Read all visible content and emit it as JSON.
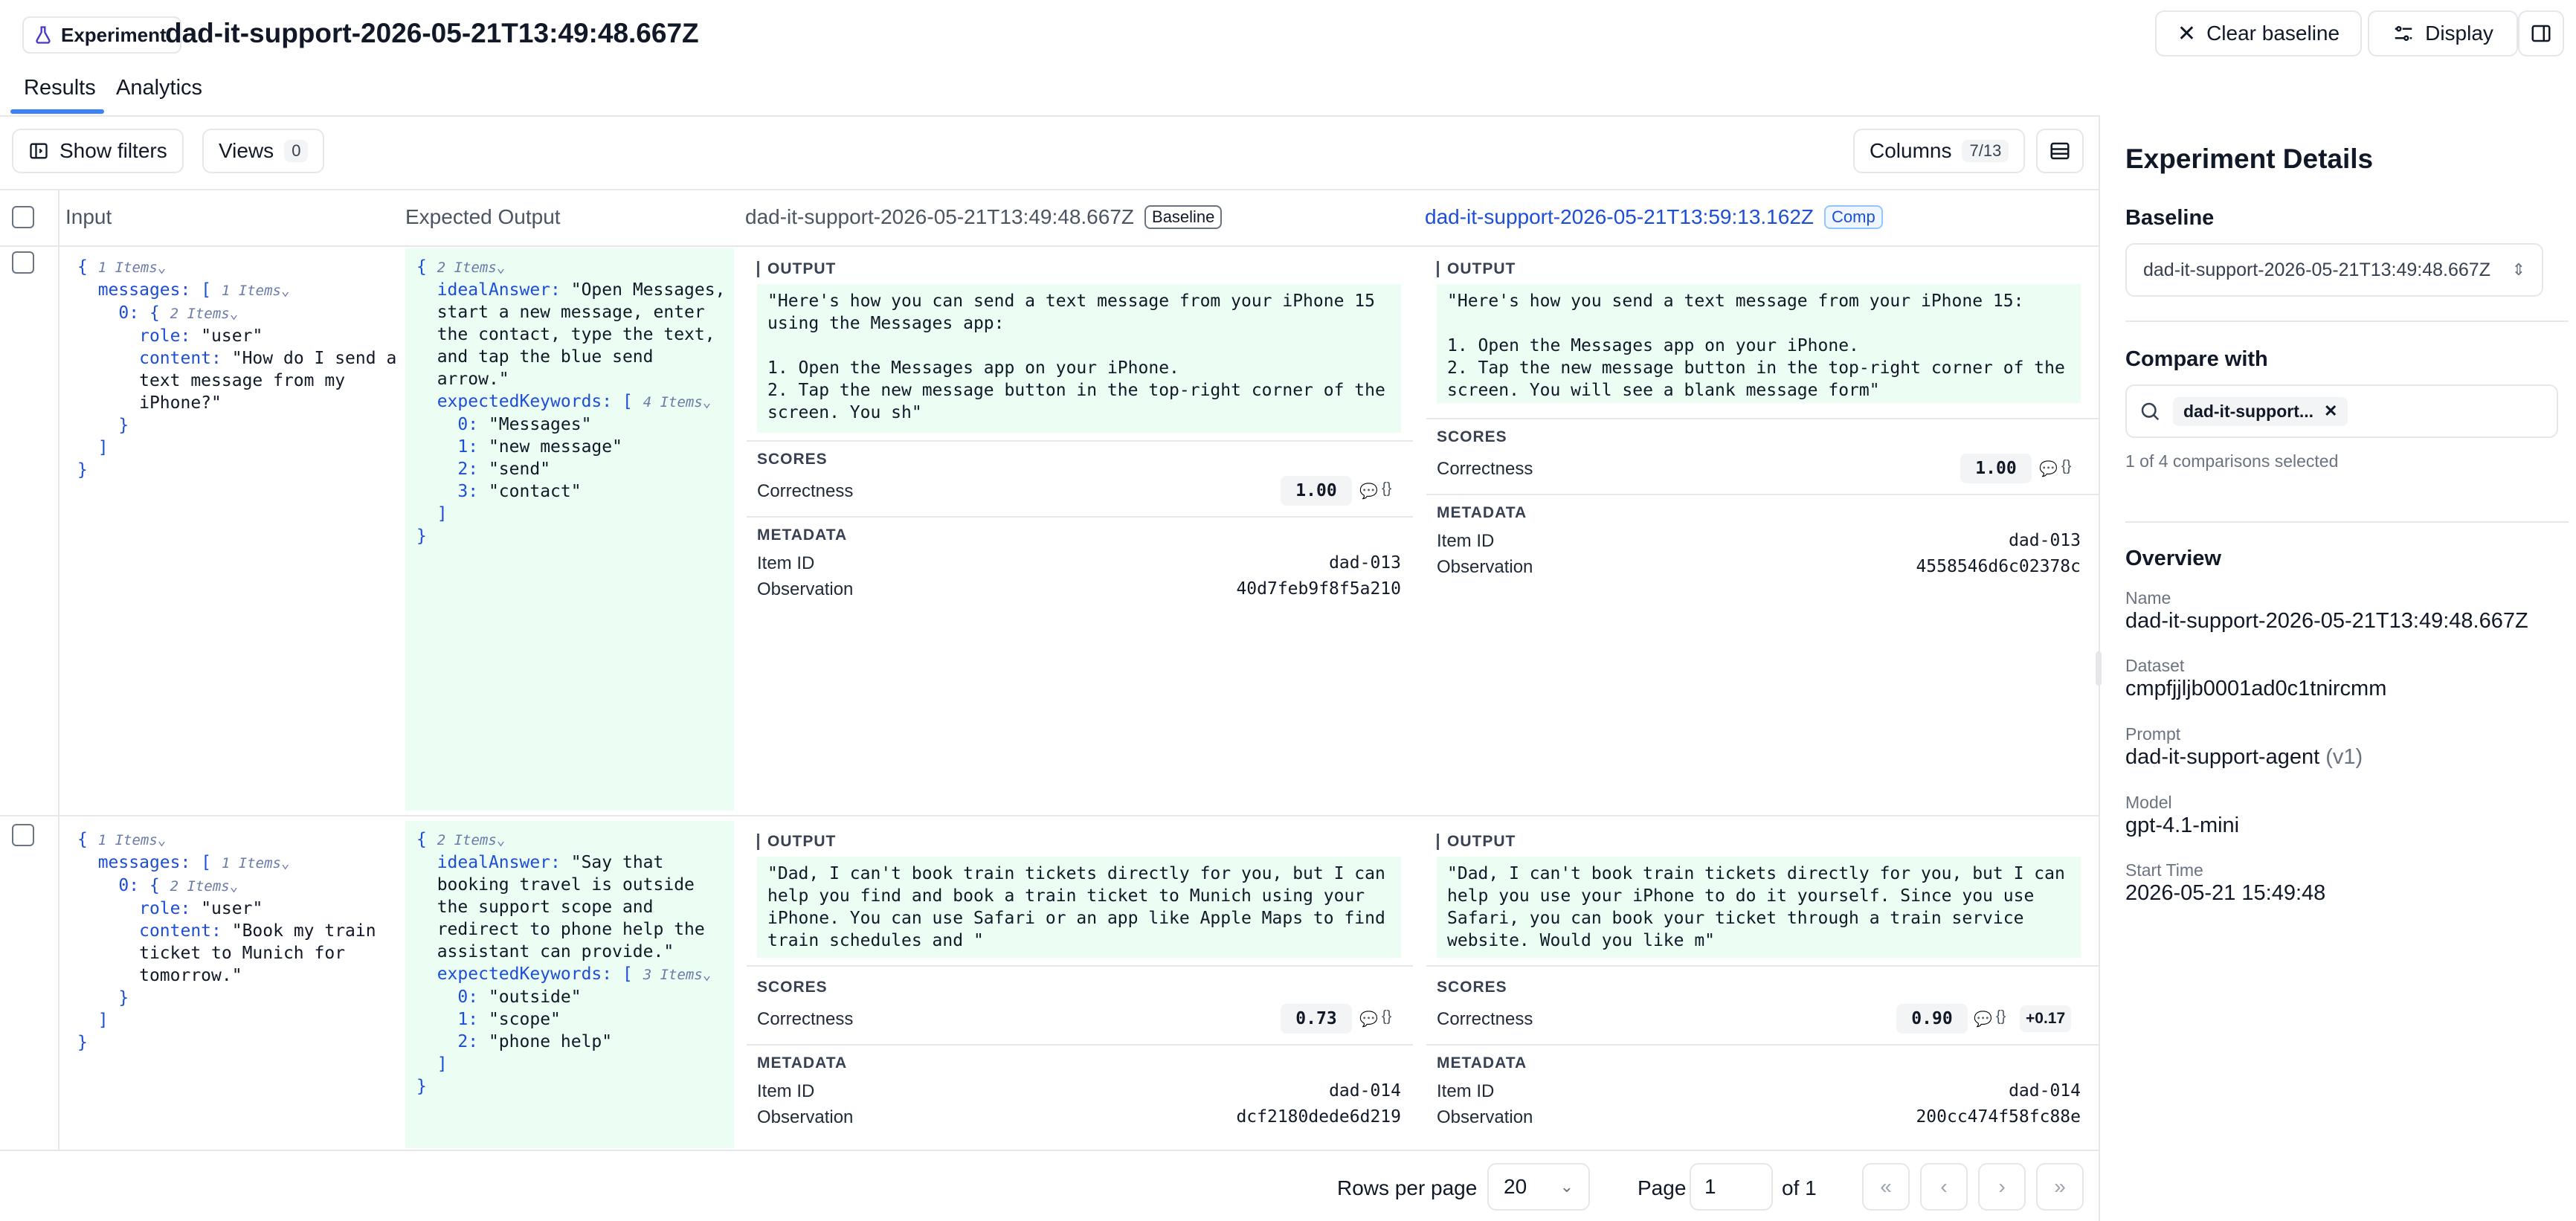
{
  "header": {
    "badge_label": "Experiment",
    "title": "dad-it-support-2026-05-21T13:49:48.667Z",
    "clear_baseline_label": "Clear baseline",
    "display_label": "Display"
  },
  "tabs": [
    {
      "label": "Results",
      "active": true
    },
    {
      "label": "Analytics",
      "active": false
    }
  ],
  "toolbar": {
    "show_filters_label": "Show filters",
    "views_label": "Views",
    "views_count": "0",
    "columns_label": "Columns",
    "columns_count": "7/13"
  },
  "columns": {
    "input": "Input",
    "expected_output": "Expected Output",
    "baseline_run": "dad-it-support-2026-05-21T13:49:48.667Z",
    "baseline_badge": "Baseline",
    "comparison_run": "dad-it-support-2026-05-21T13:59:13.162Z",
    "comparison_badge": "Comp"
  },
  "labels": {
    "output": "OUTPUT",
    "scores": "SCORES",
    "metadata": "METADATA",
    "correctness": "Correctness",
    "item_id": "Item ID",
    "observation": "Observation"
  },
  "rows": [
    {
      "input": {
        "root_meta": "1 Items",
        "messages_key": "messages:",
        "messages_meta": "1 Items",
        "item0_meta": "2 Items",
        "role": "\"user\"",
        "content_lines": [
          "\"How do I send a",
          "text message from my",
          "iPhone?\""
        ]
      },
      "expected": {
        "root_meta": "2 Items",
        "ideal_lines": [
          "\"Open Messages,",
          "start a new message, enter",
          "the contact, type the text,",
          "and tap the blue send",
          "arrow.\""
        ],
        "keywords_meta": "4 Items",
        "keywords": [
          "\"Messages\"",
          "\"new message\"",
          "\"send\"",
          "\"contact\""
        ]
      },
      "baseline": {
        "output": "\"Here's how you can send a text message from your iPhone 15\nusing the Messages app:\n\n1. Open the Messages app on your iPhone.\n2. Tap the new message button in the top-right corner of the\nscreen. You sh\"",
        "score": "1.00",
        "item_id": "dad-013",
        "observation": "40d7feb9f8f5a210"
      },
      "comparison": {
        "output": "\"Here's how you send a text message from your iPhone 15:\n\n1. Open the Messages app on your iPhone.\n2. Tap the new message button in the top-right corner of the\nscreen. You will see a blank message form\"",
        "score": "1.00",
        "delta": "",
        "item_id": "dad-013",
        "observation": "4558546d6c02378c"
      }
    },
    {
      "input": {
        "root_meta": "1 Items",
        "messages_key": "messages:",
        "messages_meta": "1 Items",
        "item0_meta": "2 Items",
        "role": "\"user\"",
        "content_lines": [
          "\"Book my train",
          "ticket to Munich for",
          "tomorrow.\""
        ]
      },
      "expected": {
        "root_meta": "2 Items",
        "ideal_lines": [
          "\"Say that",
          "booking travel is outside",
          "the support scope and",
          "redirect to phone help the",
          "assistant can provide.\""
        ],
        "keywords_meta": "3 Items",
        "keywords": [
          "\"outside\"",
          "\"scope\"",
          "\"phone help\""
        ]
      },
      "baseline": {
        "output": "\"Dad, I can't book train tickets directly for you, but I can\nhelp you find and book a train ticket to Munich using your\niPhone. You can use Safari or an app like Apple Maps to find\ntrain schedules and \"",
        "score": "0.73",
        "item_id": "dad-014",
        "observation": "dcf2180dede6d219"
      },
      "comparison": {
        "output": "\"Dad, I can't book train tickets directly for you, but I can\nhelp you use your iPhone to do it yourself. Since you use\nSafari, you can book your ticket through a train service\nwebsite. Would you like m\"",
        "score": "0.90",
        "delta": "+0.17",
        "item_id": "dad-014",
        "observation": "200cc474f58fc88e"
      }
    }
  ],
  "footer": {
    "rows_per_page_label": "Rows per page",
    "rows_per_page": "20",
    "page_label": "Page",
    "page_value": "1",
    "of_label": "of 1"
  },
  "side": {
    "title": "Experiment Details",
    "baseline_label": "Baseline",
    "baseline_value": "dad-it-support-2026-05-21T13:49:48.667Z",
    "compare_label": "Compare with",
    "compare_chip": "dad-it-support...",
    "compare_count": "1 of 4 comparisons selected",
    "overview_label": "Overview",
    "name_label": "Name",
    "name_value": "dad-it-support-2026-05-21T13:49:48.667Z",
    "dataset_label": "Dataset",
    "dataset_value": "cmpfjjljb0001ad0c1tnircmm",
    "prompt_label": "Prompt",
    "prompt_value": "dad-it-support-agent",
    "prompt_version": "(v1)",
    "model_label": "Model",
    "model_value": "gpt-4.1-mini",
    "start_label": "Start Time",
    "start_value": "2026-05-21 15:49:48"
  },
  "colors": {
    "accent": "#3b82f6",
    "green_bg": "#ecfdf3",
    "border": "#e5e7eb",
    "link_blue": "#1d4ed8"
  }
}
